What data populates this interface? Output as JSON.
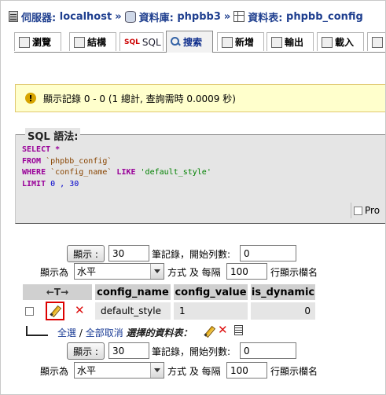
{
  "breadcrumb": {
    "server_label": "伺服器:",
    "server_value": "localhost",
    "db_label": "資料庫:",
    "db_value": "phpbb3",
    "table_label": "資料表:",
    "table_value": "phpbb_config",
    "separator": "»"
  },
  "tabs": [
    {
      "label": "瀏覽",
      "icon": "browse-icon"
    },
    {
      "label": "結構",
      "icon": "structure-icon"
    },
    {
      "label": "SQL",
      "icon": "sql-icon"
    },
    {
      "label": "搜索",
      "icon": "search-icon",
      "active": true
    },
    {
      "label": "新增",
      "icon": "insert-icon"
    },
    {
      "label": "輸出",
      "icon": "export-icon"
    },
    {
      "label": "載入",
      "icon": "import-icon"
    }
  ],
  "notice": {
    "text": "顯示記錄 0 - 0 (1 總計, 查詢需時 0.0009 秒)"
  },
  "sql": {
    "legend": "SQL 語法:",
    "kw_select": "SELECT",
    "star": " *",
    "kw_from": "FROM",
    "from_table": " `phpbb_config`",
    "kw_where": "WHERE",
    "where_col": " `config_name` ",
    "kw_like": "LIKE",
    "where_val": " 'default_style'",
    "kw_limit": "LIMIT",
    "limit_vals": " 0 , 30",
    "profiling_label": "Pro"
  },
  "nav_top": {
    "show_button": "顯示 :",
    "rows_value": "30",
    "records_label": "筆記錄，開始列數:",
    "start_value": "0",
    "display_as_label": "顯示為",
    "mode_value": "水平",
    "every_label": "方式 及 每隔",
    "repeat_value": "100",
    "repeat_suffix": "行顯示欄名"
  },
  "result_table": {
    "arrows": "←T→",
    "columns": [
      "config_name",
      "config_value",
      "is_dynamic"
    ],
    "rows": [
      {
        "config_name": "default_style",
        "config_value": "1",
        "is_dynamic": "0"
      }
    ]
  },
  "bulk": {
    "check_all": "全選",
    "slash": " / ",
    "uncheck_all": "全部取消",
    "with_selected": "選擇的資料表："
  },
  "nav_bottom": {
    "show_button": "顯示 :",
    "rows_value": "30",
    "records_label": "筆記錄，開始列數:",
    "start_value": "0",
    "display_as_label": "顯示為",
    "mode_value": "水平",
    "every_label": "方式 及 每隔",
    "repeat_value": "100",
    "repeat_suffix": "行顯示欄名"
  }
}
